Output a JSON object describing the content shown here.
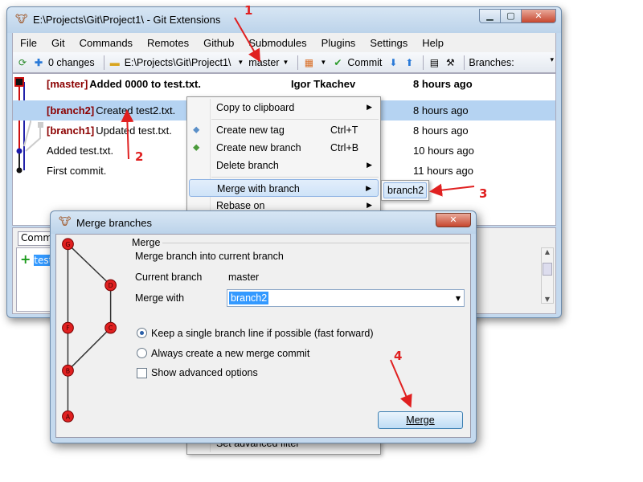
{
  "main_window": {
    "title": "E:\\Projects\\Git\\Project1\\ - Git Extensions",
    "menu": [
      "File",
      "Git",
      "Commands",
      "Remotes",
      "Github",
      "Submodules",
      "Plugins",
      "Settings",
      "Help"
    ],
    "toolbar": {
      "changes": "0 changes",
      "repo_path": "E:\\Projects\\Git\\Project1\\",
      "branch": "master",
      "commit_label": "Commit",
      "branches_label": "Branches:"
    },
    "commits": [
      {
        "tag": "[master]",
        "message": "Added 0000 to test.txt.",
        "author": "Igor Tkachev",
        "date": "8 hours ago"
      },
      {
        "tag": "[branch2]",
        "message": "Created test2.txt.",
        "author": "",
        "date": "8 hours ago"
      },
      {
        "tag": "[branch1]",
        "message": "Updated test.txt.",
        "author": "",
        "date": "8 hours ago"
      },
      {
        "tag": "",
        "message": "Added test.txt.",
        "author": "",
        "date": "10 hours ago"
      },
      {
        "tag": "",
        "message": "First commit.",
        "author": "",
        "date": "11 hours ago"
      }
    ],
    "bottom": {
      "tab_label": "Comm",
      "file_name": "test"
    }
  },
  "context_menu": {
    "copy": "Copy to clipboard",
    "new_tag": "Create new tag",
    "new_tag_shortcut": "Ctrl+T",
    "new_branch": "Create new branch",
    "new_branch_shortcut": "Ctrl+B",
    "delete_branch": "Delete branch",
    "merge_with": "Merge with branch",
    "rebase_on": "Rebase on",
    "advanced_filter": "Set advanced filter",
    "submenu_item": "branch2"
  },
  "merge_dialog": {
    "title": "Merge branches",
    "group_title": "Merge",
    "description": "Merge branch into current branch",
    "current_branch_label": "Current branch",
    "current_branch_value": "master",
    "merge_with_label": "Merge with",
    "merge_with_value": "branch2",
    "option_fast_forward": "Keep a single branch line if possible (fast forward)",
    "option_new_commit": "Always create a new merge commit",
    "option_advanced": "Show advanced options",
    "merge_button": "Merge",
    "graph_nodes": [
      "G",
      "D",
      "F",
      "C",
      "B",
      "A"
    ]
  },
  "annotations": {
    "n1": "1",
    "n2": "2",
    "n3": "3",
    "n4": "4"
  },
  "colors": {
    "accent": "#3399ff",
    "tag": "#8b0000",
    "annotation": "#e02020",
    "node": "#e02020"
  }
}
